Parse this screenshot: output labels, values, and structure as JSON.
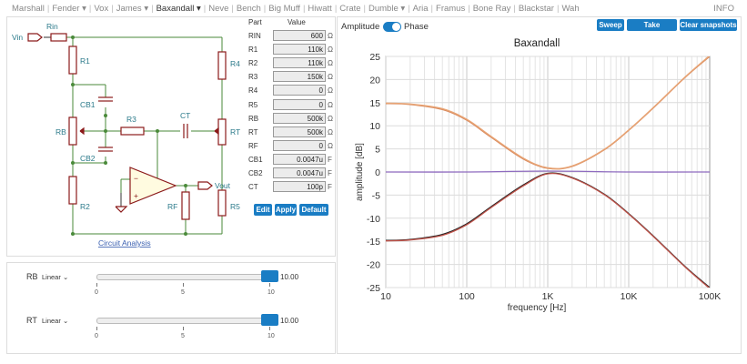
{
  "nav": {
    "items": [
      {
        "label": "Marshall",
        "dropdown": false,
        "active": false
      },
      {
        "label": "Fender",
        "dropdown": true,
        "active": false
      },
      {
        "label": "Vox",
        "dropdown": false,
        "active": false
      },
      {
        "label": "James",
        "dropdown": true,
        "active": false
      },
      {
        "label": "Baxandall",
        "dropdown": true,
        "active": true
      },
      {
        "label": "Neve",
        "dropdown": false,
        "active": false
      },
      {
        "label": "Bench",
        "dropdown": false,
        "active": false
      },
      {
        "label": "Big Muff",
        "dropdown": false,
        "active": false
      },
      {
        "label": "Hiwatt",
        "dropdown": false,
        "active": false
      },
      {
        "label": "Crate",
        "dropdown": false,
        "active": false
      },
      {
        "label": "Dumble",
        "dropdown": true,
        "active": false
      },
      {
        "label": "Aria",
        "dropdown": false,
        "active": false
      },
      {
        "label": "Framus",
        "dropdown": false,
        "active": false
      },
      {
        "label": "Bone Ray",
        "dropdown": false,
        "active": false
      },
      {
        "label": "Blackstar",
        "dropdown": false,
        "active": false
      },
      {
        "label": "Wah",
        "dropdown": false,
        "active": false
      }
    ],
    "info": "INFO"
  },
  "circuit": {
    "labels": {
      "rin": "Rin",
      "vin": "Vin",
      "r1": "R1",
      "r4": "R4",
      "cb1": "CB1",
      "rb": "RB",
      "r3": "R3",
      "ct": "CT",
      "rt": "RT",
      "cb2": "CB2",
      "vout": "Vout",
      "rf": "RF",
      "r2": "R2",
      "r5": "R5",
      "minus": "−",
      "plus": "+"
    },
    "analysis_link": "Circuit Analysis"
  },
  "params": {
    "header_part": "Part",
    "header_value": "Value",
    "rows": [
      {
        "part": "RIN",
        "value": "600",
        "unit": "Ω"
      },
      {
        "part": "R1",
        "value": "110k",
        "unit": "Ω"
      },
      {
        "part": "R2",
        "value": "110k",
        "unit": "Ω"
      },
      {
        "part": "R3",
        "value": "150k",
        "unit": "Ω"
      },
      {
        "part": "R4",
        "value": "0",
        "unit": "Ω"
      },
      {
        "part": "R5",
        "value": "0",
        "unit": "Ω"
      },
      {
        "part": "RB",
        "value": "500k",
        "unit": "Ω"
      },
      {
        "part": "RT",
        "value": "500k",
        "unit": "Ω"
      },
      {
        "part": "RF",
        "value": "0",
        "unit": "Ω"
      },
      {
        "part": "CB1",
        "value": "0.0047u",
        "unit": "F"
      },
      {
        "part": "CB2",
        "value": "0.0047u",
        "unit": "F"
      },
      {
        "part": "CT",
        "value": "100p",
        "unit": "F"
      }
    ],
    "buttons": {
      "edit": "Edit",
      "apply": "Apply",
      "default": "Default"
    }
  },
  "sliders": [
    {
      "label": "RB",
      "mode": "Linear",
      "value": "10.00",
      "level": 1.0,
      "ticks": [
        "0",
        "5",
        "10"
      ]
    },
    {
      "label": "RT",
      "mode": "Linear",
      "value": "10.00",
      "level": 1.0,
      "ticks": [
        "0",
        "5",
        "10"
      ]
    }
  ],
  "plot_controls": {
    "amplitude": "Amplitude",
    "phase": "Phase",
    "sweep": "Sweep",
    "snapshot": "Take snapshot",
    "clear": "Clear snapshots"
  },
  "chart_data": {
    "type": "line",
    "title": "Baxandall",
    "xlabel": "frequency [Hz]",
    "ylabel": "amplitude [dB]",
    "xscale": "log",
    "xlim": [
      10,
      100000
    ],
    "ylim": [
      -25,
      25
    ],
    "xticks": [
      10,
      100,
      1000,
      10000,
      100000
    ],
    "xtick_labels": [
      "10",
      "100",
      "1K",
      "10K",
      "100K"
    ],
    "yticks": [
      25,
      20,
      15,
      10,
      5,
      0,
      -5,
      -10,
      -15,
      -20,
      -25
    ],
    "grid": true,
    "series": [
      {
        "color": "#d98b5f",
        "x": [
          10,
          20,
          50,
          100,
          200,
          500,
          1000,
          2000,
          5000,
          10000,
          20000,
          50000,
          100000
        ],
        "y": [
          14.8,
          14.6,
          13.5,
          11.2,
          7.5,
          2.8,
          0.8,
          1.2,
          4.8,
          9.0,
          13.8,
          20.5,
          25.0
        ]
      },
      {
        "color": "#e8a474",
        "x": [
          10,
          20,
          50,
          100,
          200,
          500,
          1000,
          2000,
          5000,
          10000,
          20000,
          50000,
          100000
        ],
        "y": [
          14.9,
          14.7,
          13.7,
          11.4,
          7.7,
          3.0,
          0.9,
          1.3,
          4.9,
          9.1,
          13.9,
          20.6,
          25.2
        ]
      },
      {
        "color": "#222222",
        "x": [
          10,
          20,
          50,
          100,
          200,
          500,
          1000,
          2000,
          5000,
          10000,
          20000,
          50000,
          100000
        ],
        "y": [
          -14.8,
          -14.6,
          -13.5,
          -11.2,
          -7.5,
          -2.8,
          -0.3,
          -1.2,
          -4.8,
          -9.0,
          -13.8,
          -20.5,
          -25.0
        ]
      },
      {
        "color": "#c0534a",
        "x": [
          10,
          20,
          50,
          100,
          200,
          500,
          1000,
          2000,
          5000,
          10000,
          20000,
          50000,
          100000
        ],
        "y": [
          -14.9,
          -14.7,
          -13.7,
          -11.4,
          -7.7,
          -3.0,
          -0.4,
          -1.3,
          -4.9,
          -9.1,
          -13.9,
          -20.6,
          -25.2
        ]
      },
      {
        "color": "#8e6bbf",
        "x": [
          10,
          100,
          1000,
          10000,
          100000
        ],
        "y": [
          0,
          0,
          0.2,
          0,
          0
        ]
      }
    ]
  }
}
